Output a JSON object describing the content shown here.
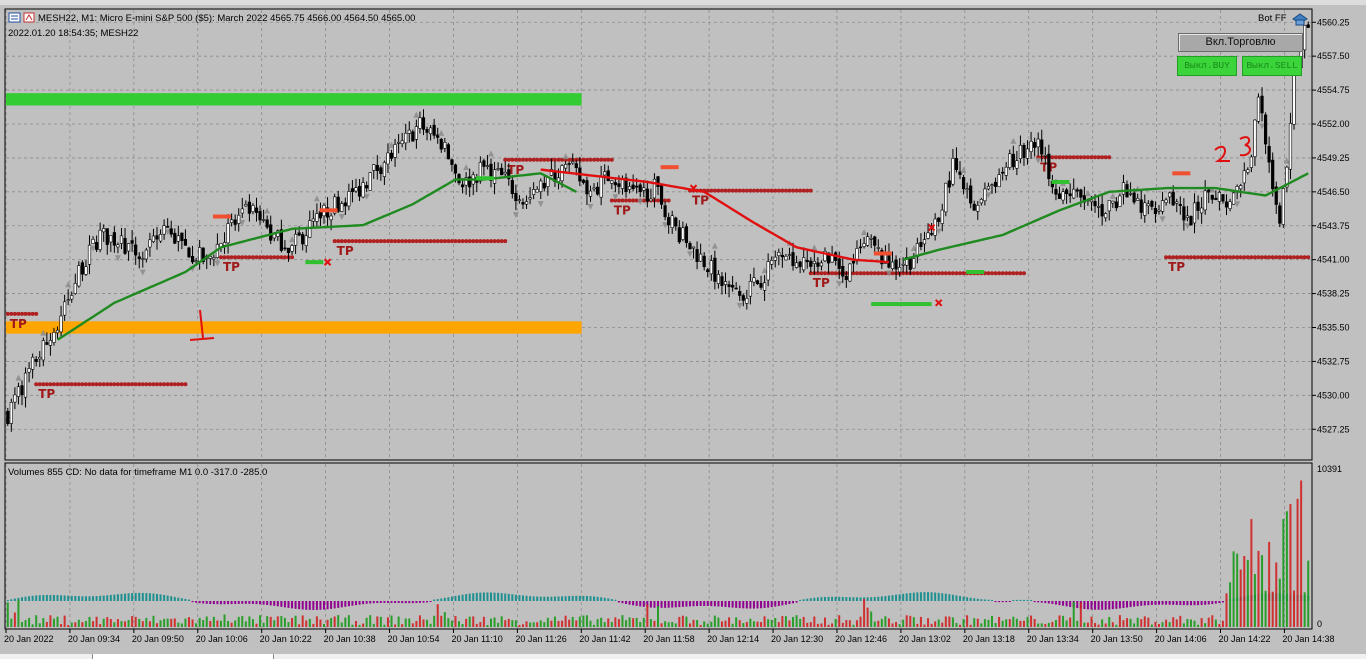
{
  "window": {
    "symbol_line": "MESH22, M1:  Micro E-mini S&P 500 ($5): March 2022  4565.75 4566.00 4564.50 4565.00",
    "datetime_line": "2022.01.20 18:54:35; MESH22",
    "bot_label": "Bot FF"
  },
  "buttons": {
    "trade": "Вкл.Торговлю",
    "buy": "Выкл.BUY",
    "sell": "Выкл.SELL"
  },
  "volumes_header": "Volumes 855 CD: No data for timeframe M1 0.0 -317.0 -285.0",
  "annotations": {
    "tp": "TP",
    "marks": [
      "1",
      "2",
      "3"
    ]
  },
  "colors": {
    "background": "#c0c0c0",
    "grid": "#8c8c8c",
    "bull": "#000000",
    "bear": "#000000",
    "ma_green": "#1f8a1f",
    "ma_red": "#e01010",
    "tp_dots": "#b02020",
    "zone_green": "#33cc33",
    "zone_orange": "#ffa500",
    "vol_teal": "#1e9090",
    "vol_purple": "#900090",
    "vol_green": "#1a9a1a",
    "vol_red": "#d02020"
  },
  "chart_data": {
    "type": "candlestick",
    "price_axis": {
      "min": 4525.0,
      "max": 4561.0,
      "ticks": [
        "4560.25",
        "4557.50",
        "4554.75",
        "4552.00",
        "4549.25",
        "4546.50",
        "4543.75",
        "4541.00",
        "4538.25",
        "4535.50",
        "4532.75",
        "4530.00",
        "4527.25"
      ]
    },
    "volume_axis": {
      "max_label": "10391",
      "min_label": "0"
    },
    "time_axis": {
      "labels": [
        "20 Jan 2022",
        "20 Jan 09:34",
        "20 Jan 09:50",
        "20 Jan 10:06",
        "20 Jan 10:22",
        "20 Jan 10:38",
        "20 Jan 10:54",
        "20 Jan 11:10",
        "20 Jan 11:26",
        "20 Jan 11:42",
        "20 Jan 11:58",
        "20 Jan 12:14",
        "20 Jan 12:30",
        "20 Jan 12:46",
        "20 Jan 13:02",
        "20 Jan 13:18",
        "20 Jan 13:34",
        "20 Jan 13:50",
        "20 Jan 14:06",
        "20 Jan 14:22",
        "20 Jan 14:38"
      ]
    },
    "close_path_keypoints": [
      [
        0,
        4528.5
      ],
      [
        8,
        4533.0
      ],
      [
        14,
        4535.5
      ],
      [
        20,
        4540.0
      ],
      [
        26,
        4543.0
      ],
      [
        32,
        4542.5
      ],
      [
        38,
        4541.0
      ],
      [
        44,
        4543.5
      ],
      [
        50,
        4542.0
      ],
      [
        56,
        4540.8
      ],
      [
        62,
        4543.5
      ],
      [
        68,
        4545.0
      ],
      [
        74,
        4543.0
      ],
      [
        80,
        4542.0
      ],
      [
        86,
        4544.0
      ],
      [
        92,
        4545.5
      ],
      [
        98,
        4546.5
      ],
      [
        104,
        4548.5
      ],
      [
        110,
        4550.0
      ],
      [
        116,
        4552.0
      ],
      [
        122,
        4550.5
      ],
      [
        128,
        4547.0
      ],
      [
        134,
        4548.5
      ],
      [
        140,
        4547.5
      ],
      [
        146,
        4545.5
      ],
      [
        152,
        4547.5
      ],
      [
        158,
        4548.5
      ],
      [
        164,
        4546.5
      ],
      [
        170,
        4548.0
      ],
      [
        176,
        4546.0
      ],
      [
        182,
        4546.8
      ],
      [
        188,
        4543.5
      ],
      [
        194,
        4541.5
      ],
      [
        200,
        4539.5
      ],
      [
        206,
        4538.0
      ],
      [
        212,
        4539.5
      ],
      [
        218,
        4542.0
      ],
      [
        224,
        4540.5
      ],
      [
        230,
        4541.5
      ],
      [
        236,
        4540.0
      ],
      [
        242,
        4542.5
      ],
      [
        248,
        4540.5
      ],
      [
        254,
        4541.0
      ],
      [
        260,
        4543.0
      ],
      [
        266,
        4548.5
      ],
      [
        272,
        4545.0
      ],
      [
        278,
        4547.5
      ],
      [
        284,
        4549.5
      ],
      [
        290,
        4550.0
      ],
      [
        296,
        4546.5
      ],
      [
        302,
        4546.0
      ],
      [
        308,
        4545.0
      ],
      [
        314,
        4546.5
      ],
      [
        320,
        4545.0
      ],
      [
        326,
        4546.0
      ],
      [
        332,
        4544.0
      ],
      [
        338,
        4546.5
      ],
      [
        344,
        4545.5
      ],
      [
        350,
        4549.5
      ],
      [
        352,
        4554.5
      ],
      [
        354,
        4551.0
      ],
      [
        356,
        4546.0
      ],
      [
        358,
        4544.5
      ],
      [
        360,
        4549.0
      ],
      [
        362,
        4556.0
      ],
      [
        364,
        4558.5
      ],
      [
        366,
        4560.5
      ]
    ],
    "ma_green_keypoints": [
      [
        14,
        4534.5
      ],
      [
        30,
        4537.5
      ],
      [
        50,
        4540.0
      ],
      [
        60,
        4542.0
      ],
      [
        80,
        4543.5
      ],
      [
        100,
        4543.8
      ],
      [
        114,
        4545.5
      ],
      [
        126,
        4547.5
      ],
      [
        134,
        4547.5
      ],
      [
        150,
        4548.0
      ],
      [
        160,
        4546.5
      ]
    ],
    "ma_red_keypoints": [
      [
        150,
        4548.3
      ],
      [
        180,
        4547.3
      ],
      [
        196,
        4546.5
      ],
      [
        210,
        4544.0
      ],
      [
        222,
        4542.0
      ],
      [
        238,
        4541.0
      ],
      [
        248,
        4540.8
      ]
    ],
    "ma_green2_keypoints": [
      [
        252,
        4541.0
      ],
      [
        262,
        4541.8
      ],
      [
        280,
        4543.0
      ],
      [
        296,
        4545.0
      ],
      [
        310,
        4546.5
      ],
      [
        326,
        4546.8
      ],
      [
        340,
        4546.8
      ],
      [
        354,
        4546.2
      ],
      [
        366,
        4548.0
      ]
    ],
    "zones": [
      {
        "name": "green-zone",
        "from": 0,
        "to": 162,
        "price": 4554.0,
        "height": 1.0
      },
      {
        "name": "orange-zone",
        "from": 0,
        "to": 162,
        "price": 4535.5,
        "height": 1.0
      }
    ],
    "tp_levels": [
      {
        "from": 8,
        "to": 50,
        "price": 4530.9
      },
      {
        "from": 0,
        "to": 8,
        "price": 4536.6
      },
      {
        "from": 60,
        "to": 80,
        "price": 4541.2
      },
      {
        "from": 92,
        "to": 140,
        "price": 4542.5
      },
      {
        "from": 140,
        "to": 170,
        "price": 4549.1
      },
      {
        "from": 170,
        "to": 186,
        "price": 4545.8
      },
      {
        "from": 192,
        "to": 226,
        "price": 4546.6
      },
      {
        "from": 226,
        "to": 286,
        "price": 4539.9
      },
      {
        "from": 290,
        "to": 310,
        "price": 4549.3
      },
      {
        "from": 326,
        "to": 366,
        "price": 4541.2
      }
    ]
  }
}
